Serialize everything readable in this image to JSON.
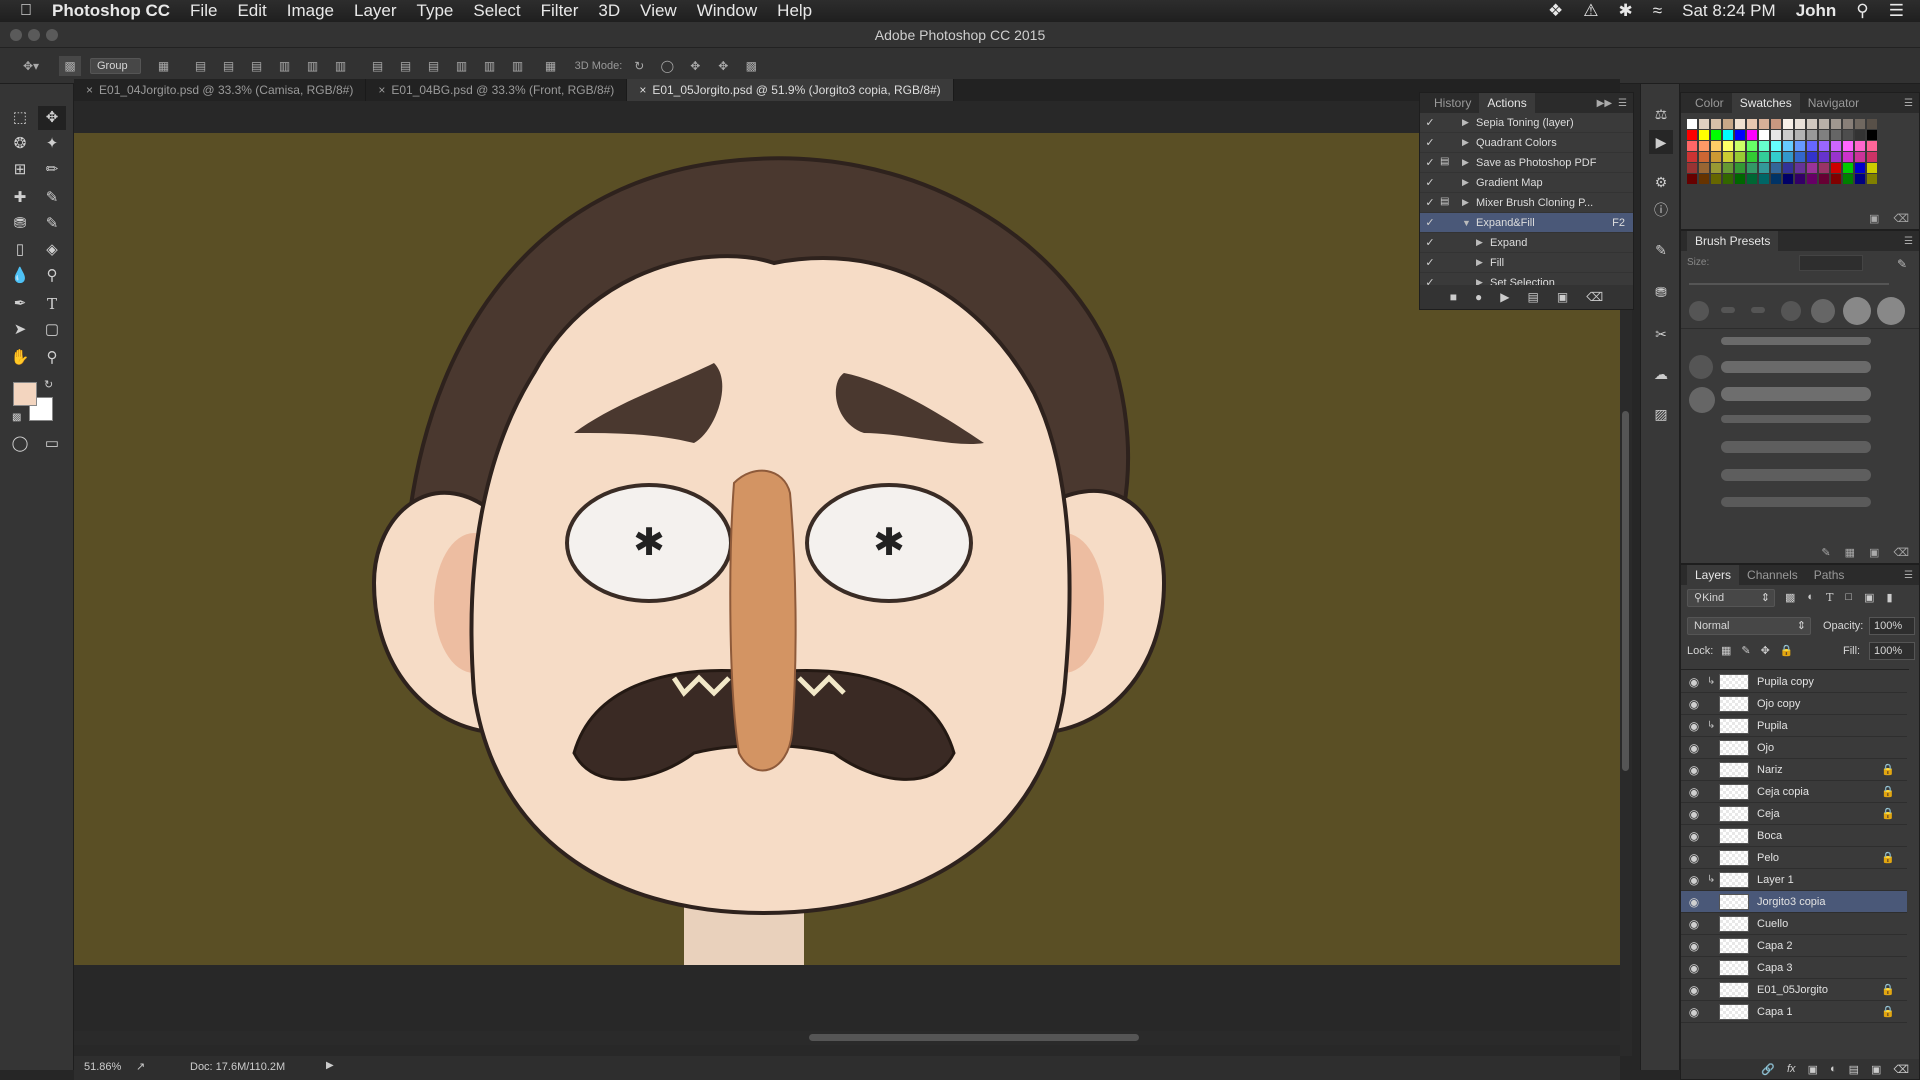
{
  "menubar": {
    "app": "Photoshop CC",
    "items": [
      "File",
      "Edit",
      "Image",
      "Layer",
      "Type",
      "Select",
      "Filter",
      "3D",
      "View",
      "Window",
      "Help"
    ],
    "clock": "Sat 8:24 PM",
    "user": "John"
  },
  "window": {
    "title": "Adobe Photoshop CC 2015"
  },
  "options": {
    "group_select": "Group",
    "mode3d": "3D Mode:"
  },
  "tabs": [
    {
      "label": "E01_04Jorgito.psd @ 33.3% (Camisa, RGB/8#)"
    },
    {
      "label": "E01_04BG.psd @ 33.3% (Front, RGB/8#)"
    },
    {
      "label": "E01_05Jorgito.psd @ 51.9% (Jorgito3 copia, RGB/8#)"
    }
  ],
  "status": {
    "zoom": "51.86%",
    "doc": "Doc: 17.6M/110.2M"
  },
  "actions_panel": {
    "tabs": [
      "History",
      "Actions"
    ],
    "rows": [
      {
        "label": "Sepia Toning (layer)",
        "level": 1
      },
      {
        "label": "Quadrant Colors",
        "level": 1
      },
      {
        "label": "Save as Photoshop PDF",
        "level": 1
      },
      {
        "label": "Gradient Map",
        "level": 1
      },
      {
        "label": "Mixer Brush Cloning P...",
        "level": 1
      },
      {
        "label": "Expand&Fill",
        "level": 1,
        "shortcut": "F2",
        "expanded": true
      },
      {
        "label": "Expand",
        "level": 2
      },
      {
        "label": "Fill",
        "level": 2
      },
      {
        "label": "Set Selection",
        "level": 2
      }
    ]
  },
  "color_panel": {
    "tabs": [
      "Color",
      "Swatches",
      "Navigator"
    ]
  },
  "brush_panel": {
    "title": "Brush Presets",
    "size_label": "Size:"
  },
  "layers_panel": {
    "tabs": [
      "Layers",
      "Channels",
      "Paths"
    ],
    "kind": "Kind",
    "blend": "Normal",
    "opacity_label": "Opacity:",
    "opacity": "100%",
    "lock_label": "Lock:",
    "fill_label": "Fill:",
    "fill": "100%",
    "layers": [
      {
        "name": "Pupila copy",
        "clip": true,
        "locked": false
      },
      {
        "name": "Ojo copy",
        "clip": false,
        "locked": false
      },
      {
        "name": "Pupila",
        "clip": true,
        "locked": false
      },
      {
        "name": "Ojo",
        "clip": false,
        "locked": false
      },
      {
        "name": "Nariz",
        "clip": false,
        "locked": true
      },
      {
        "name": "Ceja copia",
        "clip": false,
        "locked": true
      },
      {
        "name": "Ceja",
        "clip": false,
        "locked": true
      },
      {
        "name": "Boca",
        "clip": false,
        "locked": false
      },
      {
        "name": "Pelo",
        "clip": false,
        "locked": true
      },
      {
        "name": "Layer 1",
        "clip": true,
        "locked": false
      },
      {
        "name": "Jorgito3 copia",
        "clip": false,
        "locked": false,
        "selected": true
      },
      {
        "name": "Cuello",
        "clip": false,
        "locked": false
      },
      {
        "name": "Capa 2",
        "clip": false,
        "locked": false
      },
      {
        "name": "Capa 3",
        "clip": false,
        "locked": false
      },
      {
        "name": "E01_05Jorgito",
        "clip": false,
        "locked": true
      },
      {
        "name": "Capa 1",
        "clip": false,
        "locked": true
      }
    ]
  },
  "colors": {
    "canvas_bg": "#5a4f25",
    "skin": "#f6dcc6",
    "hair": "#4a382f",
    "nose": "#d39463",
    "foreground": "#f3d5bf",
    "background": "#ffffff",
    "selected_row": "#4a5878"
  }
}
